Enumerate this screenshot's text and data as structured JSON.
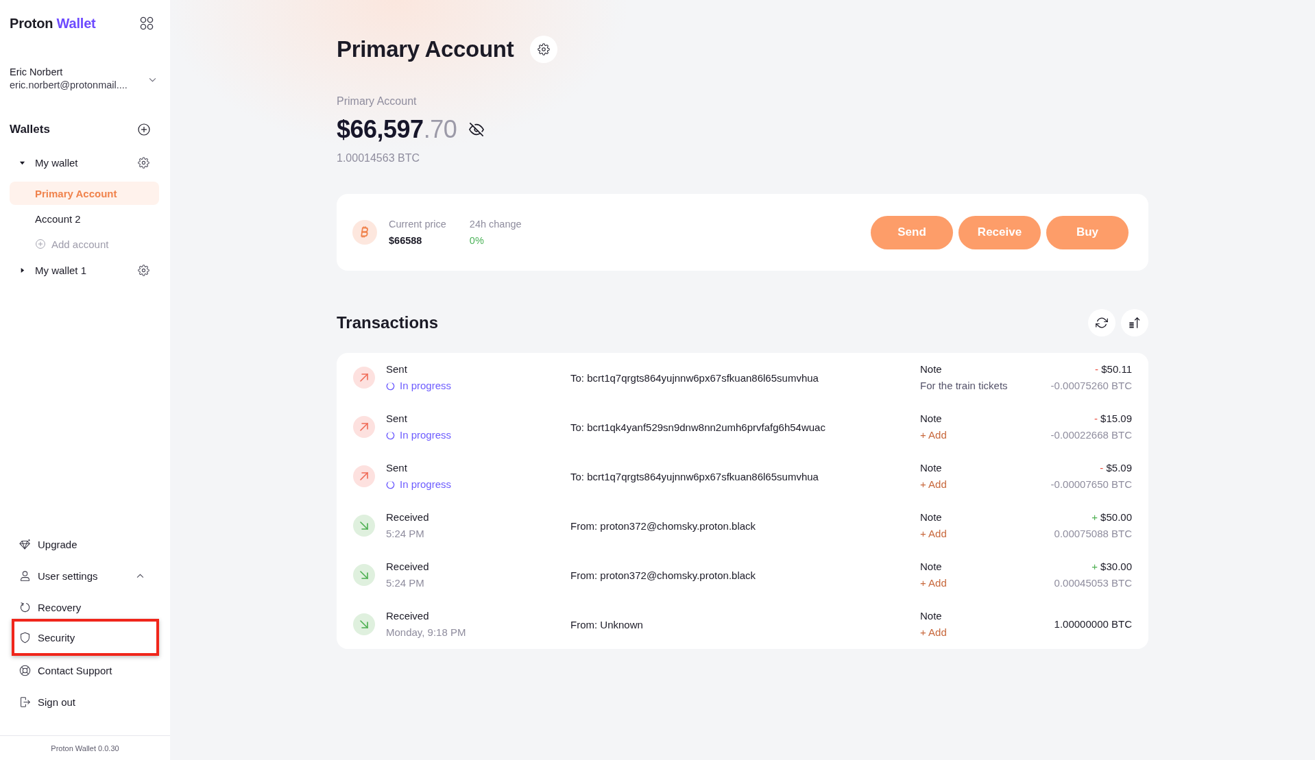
{
  "sidebar": {
    "logo": {
      "brand": "Proton",
      "product": "Wallet"
    },
    "user": {
      "name": "Eric Norbert",
      "email": "eric.norbert@protonmail...."
    },
    "wallets": {
      "title": "Wallets",
      "items": [
        {
          "name": "My wallet",
          "expanded": true,
          "children": [
            {
              "kind": "account",
              "name": "Primary Account",
              "selected": true
            },
            {
              "kind": "account",
              "name": "Account 2",
              "selected": false
            },
            {
              "kind": "add",
              "name": "Add account",
              "selected": false
            }
          ]
        },
        {
          "name": "My wallet 1",
          "expanded": false
        }
      ]
    },
    "nav": [
      {
        "kind": "link",
        "label": "Upgrade",
        "highlighted": false
      },
      {
        "kind": "group",
        "label": "User settings",
        "expanded": true,
        "highlighted": false
      },
      {
        "kind": "link",
        "label": "Recovery",
        "highlighted": false
      },
      {
        "kind": "link",
        "label": "Security",
        "highlighted": true
      },
      {
        "kind": "link",
        "label": "Contact Support",
        "highlighted": false
      },
      {
        "kind": "link",
        "label": "Sign out",
        "highlighted": false
      }
    ],
    "version": "Proton Wallet 0.0.30"
  },
  "account": {
    "title": "Primary Account",
    "balance_label": "Primary Account",
    "balance": {
      "whole": "$66,597",
      "fraction": ".70"
    },
    "btc_balance": "1.00014563 BTC"
  },
  "price_card": {
    "price_label": "Current price",
    "price": "$66588",
    "change_label": "24h change",
    "change": "0%",
    "buttons": [
      "Send",
      "Receive",
      "Buy"
    ]
  },
  "transactions": {
    "title": "Transactions",
    "rows": [
      {
        "kind": "sent",
        "type": "Sent",
        "status": "In progress",
        "pending": true,
        "address": "To: bcrt1q7qrgts864yujnnw6px67sfkuan86l65sumvhua",
        "note_label": "Note",
        "note": "For the train tickets",
        "sign": "-",
        "fiat": "$50.11",
        "btc": "-0.00075260 BTC"
      },
      {
        "kind": "sent",
        "type": "Sent",
        "status": "In progress",
        "pending": true,
        "address": "To: bcrt1qk4yanf529sn9dnw8nn2umh6prvfafg6h54wuac",
        "note_label": "Note",
        "note_action": "+ Add",
        "sign": "-",
        "fiat": "$15.09",
        "btc": "-0.00022668 BTC"
      },
      {
        "kind": "sent",
        "type": "Sent",
        "status": "In progress",
        "pending": true,
        "address": "To: bcrt1q7qrgts864yujnnw6px67sfkuan86l65sumvhua",
        "note_label": "Note",
        "note_action": "+ Add",
        "sign": "-",
        "fiat": "$5.09",
        "btc": "-0.00007650 BTC"
      },
      {
        "kind": "received",
        "type": "Received",
        "status": "5:24 PM",
        "pending": false,
        "address": "From: proton372@chomsky.proton.black",
        "note_label": "Note",
        "note_action": "+ Add",
        "sign": "+",
        "fiat": "$50.00",
        "btc": "0.00075088 BTC"
      },
      {
        "kind": "received",
        "type": "Received",
        "status": "5:24 PM",
        "pending": false,
        "address": "From: proton372@chomsky.proton.black",
        "note_label": "Note",
        "note_action": "+ Add",
        "sign": "+",
        "fiat": "$30.00",
        "btc": "0.00045053 BTC"
      },
      {
        "kind": "received",
        "type": "Received",
        "status": "Monday, 9:18 PM",
        "pending": false,
        "address": "From: Unknown",
        "note_label": "Note",
        "note_action": "+ Add",
        "btc": "1.00000000 BTC"
      }
    ]
  }
}
